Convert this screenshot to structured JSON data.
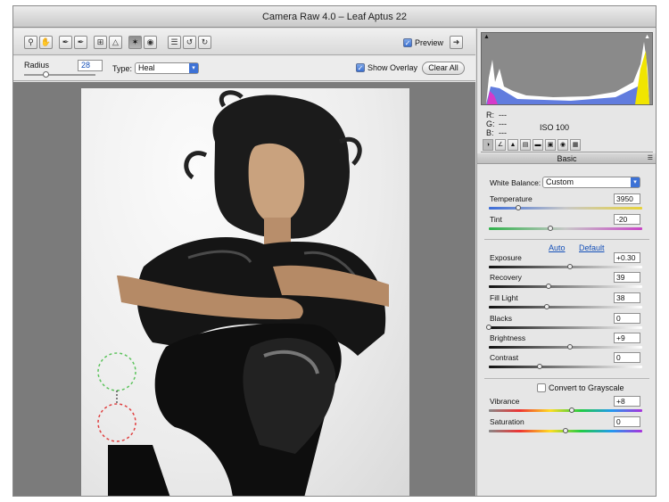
{
  "title": "Camera Raw 4.0  –  Leaf Aptus 22",
  "toolbar": {
    "tools": [
      "zoom-icon",
      "hand-icon",
      "eyedropper-icon",
      "color-sampler-icon",
      "crop-icon",
      "straighten-icon",
      "spot-removal-icon",
      "red-eye-icon",
      "preferences-icon",
      "rotate-left-icon",
      "rotate-right-icon"
    ],
    "preview_label": "Preview",
    "preview_checked": true
  },
  "options": {
    "radius_label": "Radius",
    "radius_value": "28",
    "radius_slider": 0.3,
    "type_label": "Type:",
    "type_value": "Heal",
    "show_overlay_label": "Show Overlay",
    "show_overlay_checked": true,
    "clear_all_label": "Clear All"
  },
  "rgb": {
    "r_label": "R:",
    "g_label": "G:",
    "b_label": "B:",
    "r": "---",
    "g": "---",
    "b": "---",
    "iso": "ISO 100"
  },
  "panel": {
    "section_title": "Basic",
    "white_balance_label": "White Balance:",
    "white_balance_value": "Custom",
    "auto_label": "Auto",
    "default_label": "Default",
    "grayscale_label": "Convert to Grayscale",
    "sliders": [
      {
        "label": "Temperature",
        "value": "3950",
        "pos": 0.19
      },
      {
        "label": "Tint",
        "value": "-20",
        "pos": 0.4
      },
      {
        "label": "Exposure",
        "value": "+0.30",
        "pos": 0.53
      },
      {
        "label": "Recovery",
        "value": "39",
        "pos": 0.39
      },
      {
        "label": "Fill Light",
        "value": "38",
        "pos": 0.38
      },
      {
        "label": "Blacks",
        "value": "0",
        "pos": 0.0
      },
      {
        "label": "Brightness",
        "value": "+9",
        "pos": 0.53
      },
      {
        "label": "Contrast",
        "value": "0",
        "pos": 0.33
      },
      {
        "label": "Vibrance",
        "value": "+8",
        "pos": 0.54
      },
      {
        "label": "Saturation",
        "value": "0",
        "pos": 0.5
      }
    ]
  }
}
